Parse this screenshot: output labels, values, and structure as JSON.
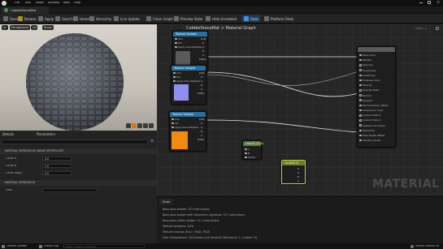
{
  "window": {
    "menu": [
      "File",
      "Edit",
      "Asset",
      "Window",
      "Tools",
      "Help"
    ],
    "tab_label": "CobbleStoneMat"
  },
  "toolbar": {
    "buttons": [
      "Save",
      "Browse",
      "Apply",
      "Search",
      "Home",
      "Hierarchy",
      "Live Update",
      "Clean Graph",
      "Preview State",
      "Hide Unrelated",
      "Stats",
      "Platform Stats"
    ]
  },
  "viewport": {
    "perspective": "Perspective",
    "lit": "Lit",
    "show": "Show"
  },
  "details": {
    "tabs": [
      "Details",
      "Parameters"
    ],
    "section1": "MATERIAL EXPRESSION LINEAR INTERPOLATE",
    "props": [
      {
        "label": "Const A",
        "value": "0.0"
      },
      {
        "label": "Const B",
        "value": "1.0"
      },
      {
        "label": "Const Alpha",
        "value": "0.5"
      }
    ],
    "section2": "MATERIAL EXPRESSION",
    "desc_label": "Desc"
  },
  "graph": {
    "breadcrumb_root": "CobbleStoneMat",
    "breadcrumb_sep": ">",
    "breadcrumb_leaf": "Material Graph",
    "zoom": "Zoom -2",
    "watermark": "MATERIAL",
    "nodes": {
      "tex1": {
        "title": "Texture Sample",
        "pins": [
          "UVs",
          "Tex",
          "Apply View MipBias",
          "RGB",
          "R",
          "G",
          "B",
          "A",
          "RGBA"
        ]
      },
      "tex2": {
        "title": "Texture Sample",
        "pins": [
          "UVs",
          "Tex",
          "Apply View MipBias",
          "RGB",
          "R",
          "G",
          "B",
          "A",
          "RGBA"
        ]
      },
      "tex3": {
        "title": "Texture Sample",
        "pins": [
          "UVs",
          "Tex",
          "Apply View MipBias",
          "RGB",
          "R",
          "G",
          "B",
          "A",
          "RGBA"
        ]
      },
      "lerp": {
        "title": "Lerp(0,1,0.5)",
        "pins": [
          "A",
          "B",
          "Alpha"
        ]
      },
      "const": {
        "title": "Const(0.5)",
        "pins": [
          "R",
          "G",
          "B",
          "A"
        ]
      },
      "result": {
        "title": "",
        "pins": [
          "Base Color",
          "Metallic",
          "Specular",
          "Roughness",
          "Anisotropy",
          "Emissive Color",
          "Opacity",
          "Opacity Mask",
          "Normal",
          "Tangent",
          "World Position Offset",
          "Subsurface Color",
          "Custom Data 0",
          "Custom Data 1",
          "Ambient Occlusion",
          "Refraction",
          "Pixel Depth Offset",
          "Shading Model"
        ]
      }
    }
  },
  "stats": {
    "tab": "Stats",
    "lines": [
      "Base pass shader: 137 instructions",
      "Base pass shader with Volumetric Lightmap: 127 instructions",
      "Base pass vertex shader: 111 instructions",
      "Texture samplers: 3/16",
      "Texture Lookups (Est.): VS(0), PS(3)",
      "User interpolators: 2/4 Scalars (1/4 Vectors) (TexCoords: 2, Custom: 0)"
    ]
  },
  "statusbar": {
    "content_drawer": "Content Drawer",
    "output_log": "Output Log",
    "cmd_placeholder": "Enter Console Command",
    "source_control": "Source Control Off"
  },
  "colors": {
    "texture_header": "#2a6f9c",
    "lerp_header": "#527a3b",
    "const_header": "#6b7a2a",
    "result_header": "#5a5a5a",
    "swatch_gray": "#5a5a5a",
    "swatch_purple": "#8f8ff0",
    "swatch_orange": "#f08a10"
  }
}
